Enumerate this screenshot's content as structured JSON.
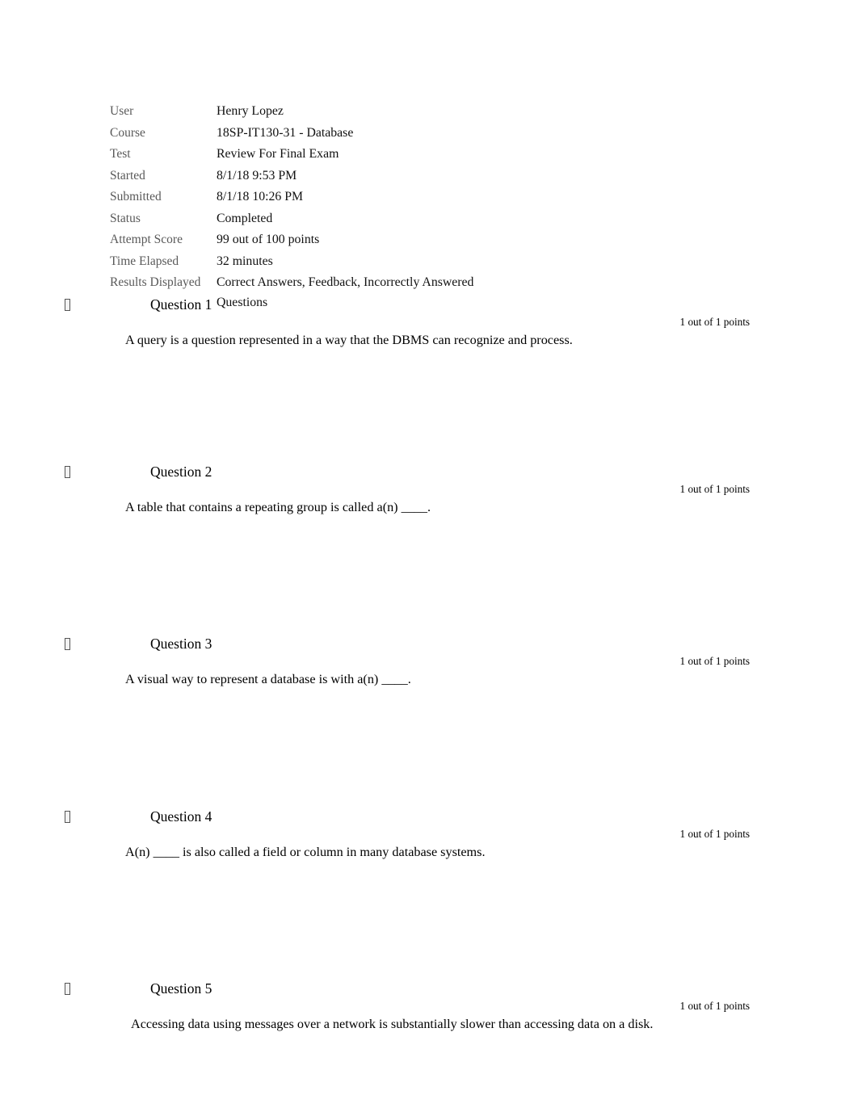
{
  "summary": {
    "rows": [
      {
        "label": "User",
        "value": "Henry Lopez"
      },
      {
        "label": "Course",
        "value": "18SP-IT130-31 - Database"
      },
      {
        "label": "Test",
        "value": "Review For Final Exam"
      },
      {
        "label": "Started",
        "value": "8/1/18 9:53 PM"
      },
      {
        "label": "Submitted",
        "value": "8/1/18 10:26 PM"
      },
      {
        "label": "Status",
        "value": "Completed"
      },
      {
        "label": "Attempt Score",
        "value": "99 out of 100 points"
      },
      {
        "label": "Time Elapsed",
        "value": "32 minutes"
      },
      {
        "label": "Results Displayed",
        "value": "Correct Answers, Feedback, Incorrectly Answered Questions"
      }
    ]
  },
  "questions": [
    {
      "marker": "missing-glyph-box",
      "title": "Question 1",
      "points": "1 out of 1 points",
      "text": "A query is a question represented in a way that the DBMS can recognize and process."
    },
    {
      "marker": "missing-glyph-box",
      "title": "Question 2",
      "points": "1 out of 1 points",
      "text": "A table that contains a repeating group is called a(n) ____."
    },
    {
      "marker": "missing-glyph-box",
      "title": "Question 3",
      "points": "1 out of 1 points",
      "text": "A visual way to represent a database is with a(n) ____."
    },
    {
      "marker": "missing-glyph-box",
      "title": "Question 4",
      "points": "1 out of 1 points",
      "text": "A(n) ____ is also called a field or column in many database systems."
    },
    {
      "marker": "missing-glyph-box",
      "title": "Question 5",
      "points": "1 out of 1 points",
      "text": "Accessing data using messages over a network is substantially slower than accessing data on a disk."
    }
  ],
  "colors": {
    "page_background": "#ffffff",
    "label_text": "#595959",
    "body_text": "#000000"
  }
}
